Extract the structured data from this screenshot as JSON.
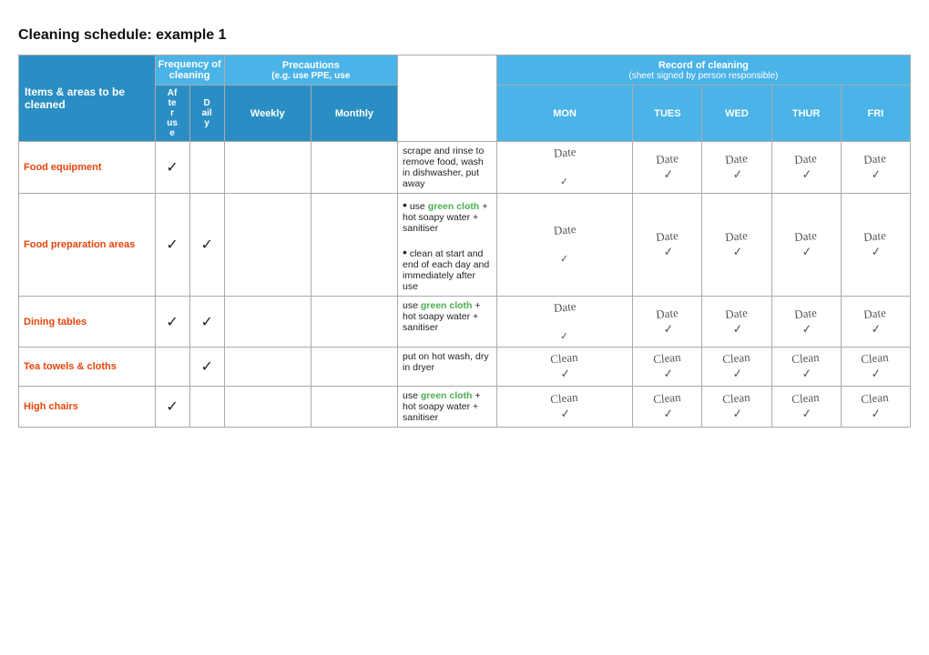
{
  "title": "Cleaning schedule: example 1",
  "header": {
    "frequency_label": "Frequency of cleaning",
    "precautions_label": "Precautions",
    "precautions_sub": "(e.g. use PPE, use",
    "record_label": "Record of cleaning",
    "record_sub": "(sheet signed by person responsible)",
    "items_label": "Items & areas to be cleaned",
    "after_label": "After use",
    "daily_label": "Daily",
    "weekly_label": "Weekly",
    "monthly_label": "Monthly",
    "mon_label": "MON",
    "tues_label": "TUES",
    "wed_label": "WED",
    "thur_label": "THUR",
    "fri_label": "FRI"
  },
  "rows": [
    {
      "item": "Food equipment",
      "after": "✓",
      "daily": "",
      "weekly": "",
      "monthly": "",
      "instructions": "scrape and rinse to remove food, wash in dishwasher, put away",
      "green_part": "",
      "instructions2": "",
      "signature": "Date"
    },
    {
      "item": "Food preparation areas",
      "after": "✓",
      "daily": "✓",
      "weekly": "",
      "monthly": "",
      "instructions_pre": "use ",
      "green_word": "green cloth",
      "instructions_post": " + hot soapy water + sanitiser",
      "instructions2_pre": "clean at start and end of each day and immediately after use",
      "signature": "Date"
    },
    {
      "item": "Dining tables",
      "after": "✓",
      "daily": "✓",
      "weekly": "",
      "monthly": "",
      "instructions_pre": "use ",
      "green_word": "green cloth",
      "instructions_post": " + hot soapy water + sanitiser",
      "signature": "Date"
    },
    {
      "item": "Tea towels & cloths",
      "after": "",
      "daily": "✓",
      "weekly": "",
      "monthly": "",
      "instructions": "put on hot wash, dry in dryer",
      "green_part": "",
      "signature": "Clean"
    },
    {
      "item": "High chairs",
      "after": "✓",
      "daily": "",
      "weekly": "",
      "monthly": "",
      "instructions_pre": "use ",
      "green_word": "green cloth",
      "instructions_post": " + hot soapy water + sanitiser",
      "signature": "Clean"
    }
  ]
}
